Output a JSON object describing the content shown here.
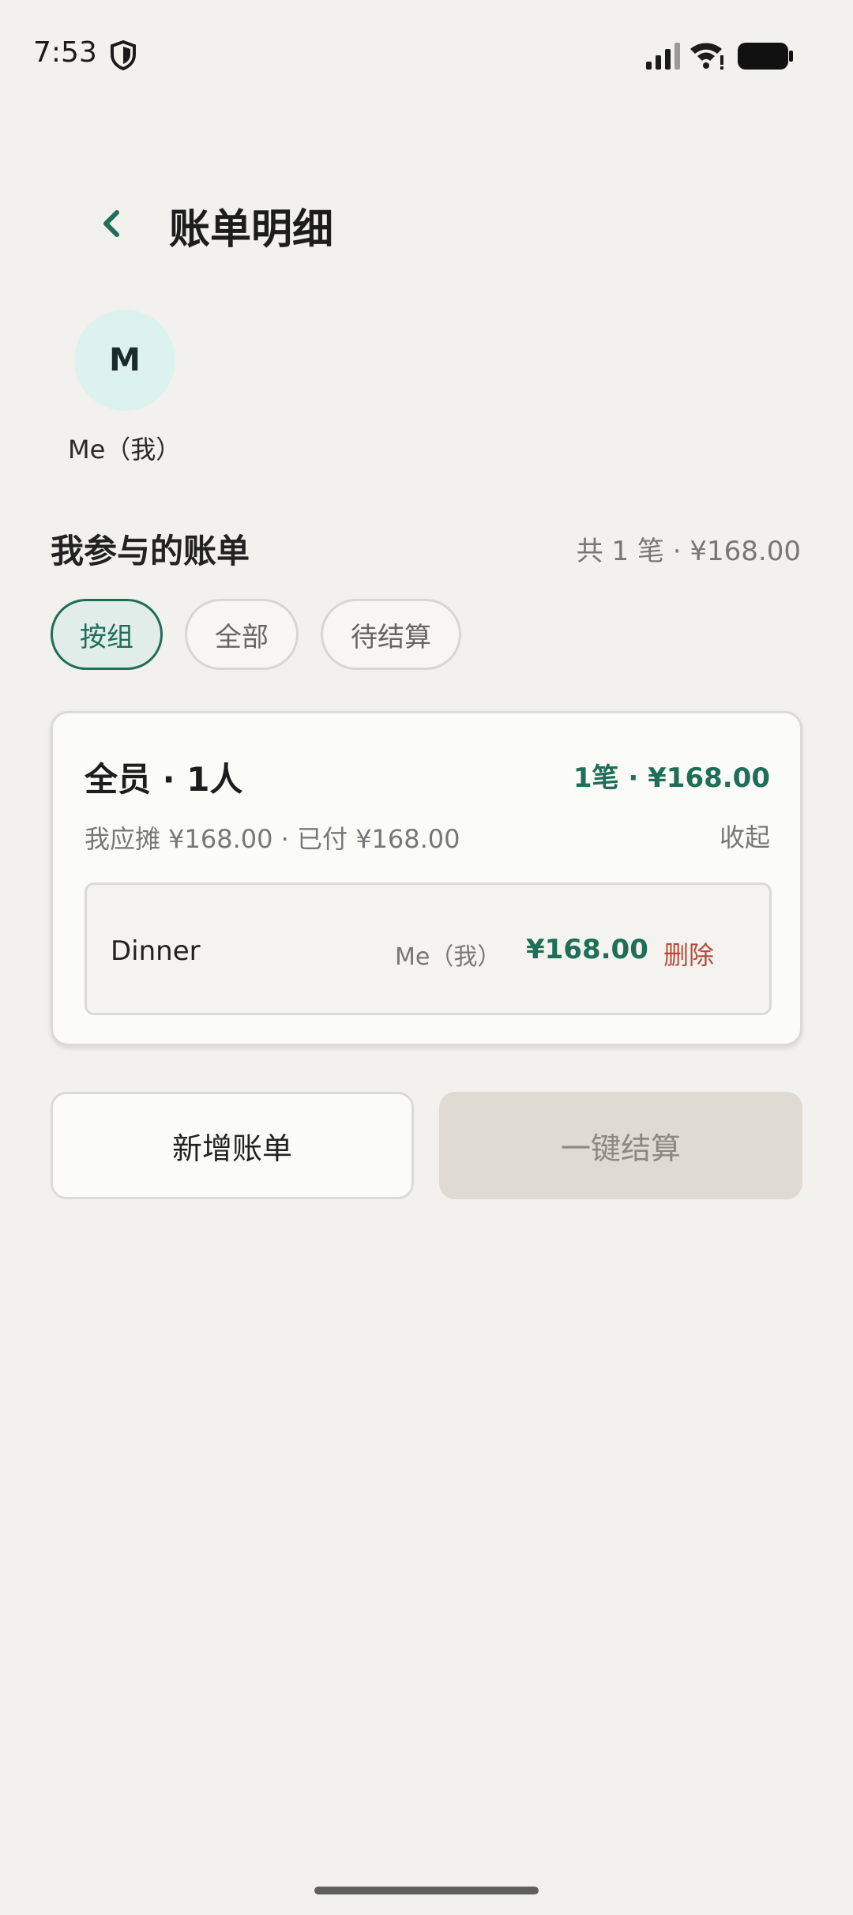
{
  "status_bar": {
    "time": "7:53",
    "icons": [
      "shield-icon",
      "signal-icon",
      "wifi-icon",
      "battery-icon"
    ]
  },
  "header": {
    "back_icon": "chevron-left-icon",
    "title": "账单明细"
  },
  "member": {
    "avatar_letter": "M",
    "name": "Me（我）",
    "avatar_color": "#dcf2ee"
  },
  "section": {
    "title": "我参与的账单",
    "summary": "共 1 笔 · ¥168.00"
  },
  "filters": [
    {
      "label": "按组",
      "selected": true
    },
    {
      "label": "全部",
      "selected": false
    },
    {
      "label": "待结算",
      "selected": false
    }
  ],
  "group_card": {
    "title": "全员 · 1人",
    "total": "1笔 · ¥168.00",
    "subtitle": "我应摊 ¥168.00 · 已付 ¥168.00",
    "collapse_label": "收起",
    "bills": [
      {
        "name": "Dinner",
        "payer": "Me（我）",
        "amount": "¥168.00",
        "delete_label": "删除"
      }
    ]
  },
  "actions": {
    "add_bill": "新增账单",
    "settle": "一键结算"
  },
  "colors": {
    "accent": "#1f6e57",
    "danger": "#b84a3a",
    "background": "#f2f1ed"
  }
}
